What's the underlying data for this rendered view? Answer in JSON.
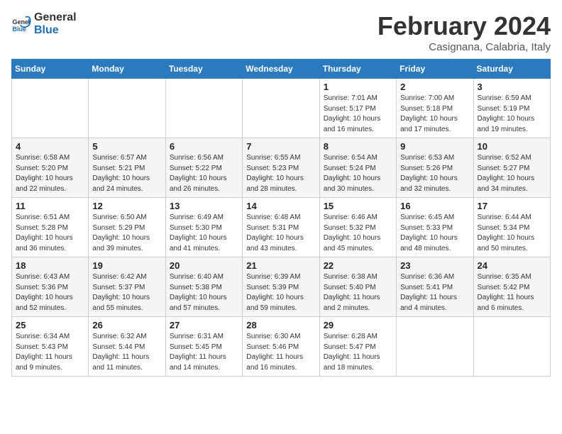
{
  "logo": {
    "line1": "General",
    "line2": "Blue"
  },
  "title": "February 2024",
  "subtitle": "Casignana, Calabria, Italy",
  "weekdays": [
    "Sunday",
    "Monday",
    "Tuesday",
    "Wednesday",
    "Thursday",
    "Friday",
    "Saturday"
  ],
  "weeks": [
    [
      {
        "day": "",
        "info": ""
      },
      {
        "day": "",
        "info": ""
      },
      {
        "day": "",
        "info": ""
      },
      {
        "day": "",
        "info": ""
      },
      {
        "day": "1",
        "info": "Sunrise: 7:01 AM\nSunset: 5:17 PM\nDaylight: 10 hours\nand 16 minutes."
      },
      {
        "day": "2",
        "info": "Sunrise: 7:00 AM\nSunset: 5:18 PM\nDaylight: 10 hours\nand 17 minutes."
      },
      {
        "day": "3",
        "info": "Sunrise: 6:59 AM\nSunset: 5:19 PM\nDaylight: 10 hours\nand 19 minutes."
      }
    ],
    [
      {
        "day": "4",
        "info": "Sunrise: 6:58 AM\nSunset: 5:20 PM\nDaylight: 10 hours\nand 22 minutes."
      },
      {
        "day": "5",
        "info": "Sunrise: 6:57 AM\nSunset: 5:21 PM\nDaylight: 10 hours\nand 24 minutes."
      },
      {
        "day": "6",
        "info": "Sunrise: 6:56 AM\nSunset: 5:22 PM\nDaylight: 10 hours\nand 26 minutes."
      },
      {
        "day": "7",
        "info": "Sunrise: 6:55 AM\nSunset: 5:23 PM\nDaylight: 10 hours\nand 28 minutes."
      },
      {
        "day": "8",
        "info": "Sunrise: 6:54 AM\nSunset: 5:24 PM\nDaylight: 10 hours\nand 30 minutes."
      },
      {
        "day": "9",
        "info": "Sunrise: 6:53 AM\nSunset: 5:26 PM\nDaylight: 10 hours\nand 32 minutes."
      },
      {
        "day": "10",
        "info": "Sunrise: 6:52 AM\nSunset: 5:27 PM\nDaylight: 10 hours\nand 34 minutes."
      }
    ],
    [
      {
        "day": "11",
        "info": "Sunrise: 6:51 AM\nSunset: 5:28 PM\nDaylight: 10 hours\nand 36 minutes."
      },
      {
        "day": "12",
        "info": "Sunrise: 6:50 AM\nSunset: 5:29 PM\nDaylight: 10 hours\nand 39 minutes."
      },
      {
        "day": "13",
        "info": "Sunrise: 6:49 AM\nSunset: 5:30 PM\nDaylight: 10 hours\nand 41 minutes."
      },
      {
        "day": "14",
        "info": "Sunrise: 6:48 AM\nSunset: 5:31 PM\nDaylight: 10 hours\nand 43 minutes."
      },
      {
        "day": "15",
        "info": "Sunrise: 6:46 AM\nSunset: 5:32 PM\nDaylight: 10 hours\nand 45 minutes."
      },
      {
        "day": "16",
        "info": "Sunrise: 6:45 AM\nSunset: 5:33 PM\nDaylight: 10 hours\nand 48 minutes."
      },
      {
        "day": "17",
        "info": "Sunrise: 6:44 AM\nSunset: 5:34 PM\nDaylight: 10 hours\nand 50 minutes."
      }
    ],
    [
      {
        "day": "18",
        "info": "Sunrise: 6:43 AM\nSunset: 5:36 PM\nDaylight: 10 hours\nand 52 minutes."
      },
      {
        "day": "19",
        "info": "Sunrise: 6:42 AM\nSunset: 5:37 PM\nDaylight: 10 hours\nand 55 minutes."
      },
      {
        "day": "20",
        "info": "Sunrise: 6:40 AM\nSunset: 5:38 PM\nDaylight: 10 hours\nand 57 minutes."
      },
      {
        "day": "21",
        "info": "Sunrise: 6:39 AM\nSunset: 5:39 PM\nDaylight: 10 hours\nand 59 minutes."
      },
      {
        "day": "22",
        "info": "Sunrise: 6:38 AM\nSunset: 5:40 PM\nDaylight: 11 hours\nand 2 minutes."
      },
      {
        "day": "23",
        "info": "Sunrise: 6:36 AM\nSunset: 5:41 PM\nDaylight: 11 hours\nand 4 minutes."
      },
      {
        "day": "24",
        "info": "Sunrise: 6:35 AM\nSunset: 5:42 PM\nDaylight: 11 hours\nand 6 minutes."
      }
    ],
    [
      {
        "day": "25",
        "info": "Sunrise: 6:34 AM\nSunset: 5:43 PM\nDaylight: 11 hours\nand 9 minutes."
      },
      {
        "day": "26",
        "info": "Sunrise: 6:32 AM\nSunset: 5:44 PM\nDaylight: 11 hours\nand 11 minutes."
      },
      {
        "day": "27",
        "info": "Sunrise: 6:31 AM\nSunset: 5:45 PM\nDaylight: 11 hours\nand 14 minutes."
      },
      {
        "day": "28",
        "info": "Sunrise: 6:30 AM\nSunset: 5:46 PM\nDaylight: 11 hours\nand 16 minutes."
      },
      {
        "day": "29",
        "info": "Sunrise: 6:28 AM\nSunset: 5:47 PM\nDaylight: 11 hours\nand 18 minutes."
      },
      {
        "day": "",
        "info": ""
      },
      {
        "day": "",
        "info": ""
      }
    ]
  ]
}
